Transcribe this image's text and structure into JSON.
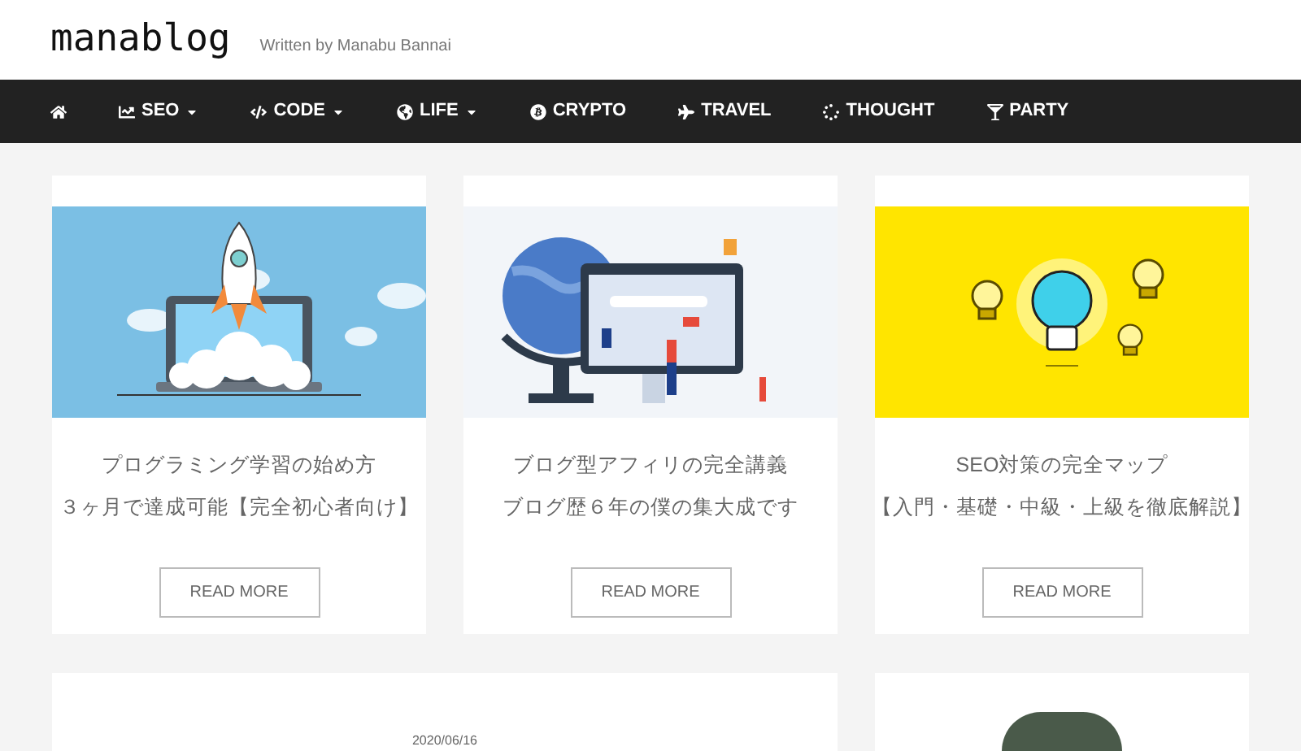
{
  "header": {
    "logo": "manablog",
    "tagline": "Written by Manabu Bannai"
  },
  "nav": [
    {
      "label": "SEO",
      "dropdown": true
    },
    {
      "label": "CODE",
      "dropdown": true
    },
    {
      "label": "LIFE",
      "dropdown": true
    },
    {
      "label": "CRYPTO",
      "dropdown": false
    },
    {
      "label": "TRAVEL",
      "dropdown": false
    },
    {
      "label": "THOUGHT",
      "dropdown": false
    },
    {
      "label": "PARTY",
      "dropdown": false
    }
  ],
  "cards": [
    {
      "kind": "rocket",
      "title": [
        "プログラミング学習の始め方",
        "３ヶ月で達成可能【完全初心者向け】"
      ],
      "button": "READ MORE"
    },
    {
      "kind": "globe",
      "title": [
        "ブログ型アフィリの完全講義",
        "ブログ歴６年の僕の集大成です"
      ],
      "button": "READ MORE"
    },
    {
      "kind": "bulb",
      "title": [
        "SEO対策の完全マップ",
        "【入門・基礎・中級・上級を徹底解説】"
      ],
      "button": "READ MORE"
    }
  ],
  "post": {
    "date": "2020/06/16"
  }
}
